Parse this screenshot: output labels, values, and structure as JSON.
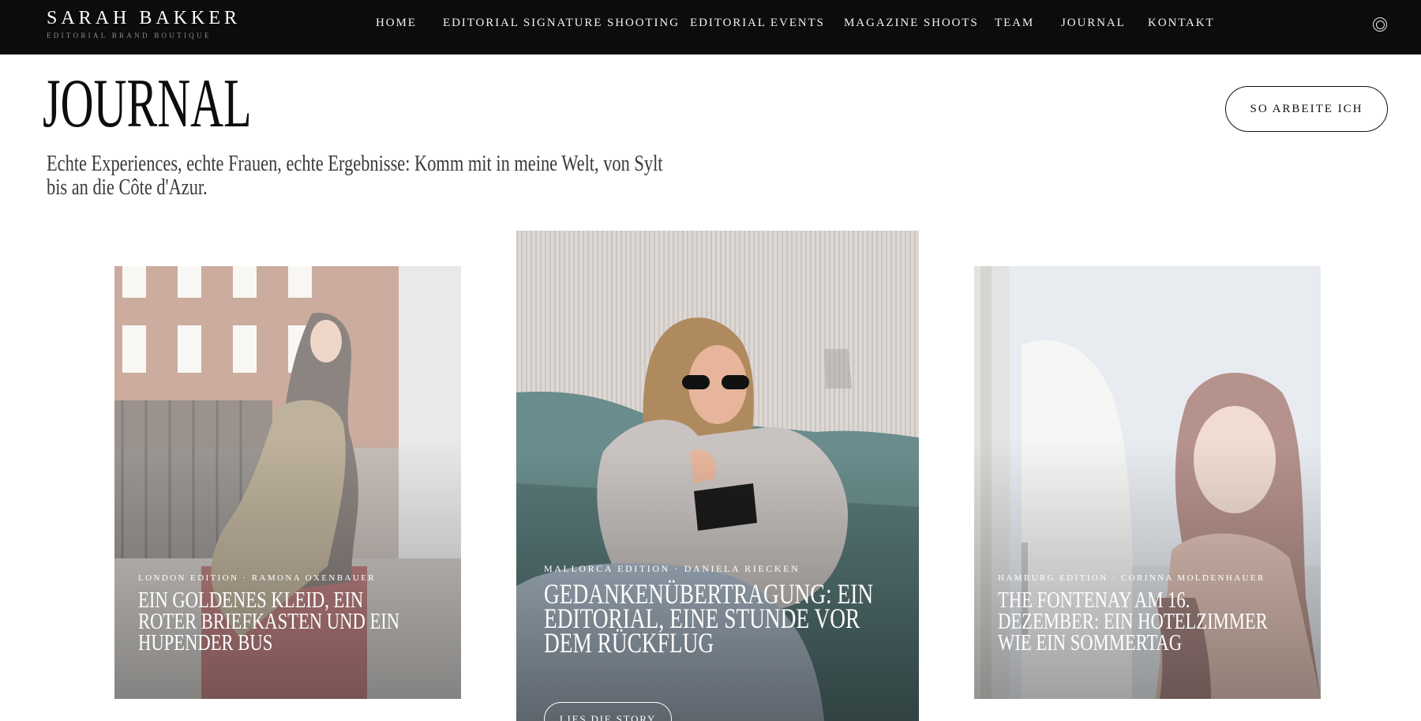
{
  "header": {
    "brand_name": "SARAH BAKKER",
    "brand_tagline": "EDITORIAL BRAND BOUTIQUE",
    "nav": [
      {
        "label": "HOME"
      },
      {
        "label": "EDITORIAL SIGNATURE SHOOTING"
      },
      {
        "label": "EDITORIAL EVENTS"
      },
      {
        "label": "MAGAZINE SHOOTS"
      },
      {
        "label": "TEAM"
      },
      {
        "label": "JOURNAL"
      },
      {
        "label": "KONTAKT"
      }
    ],
    "social_icon": "instagram-icon"
  },
  "page": {
    "title": "JOURNAL",
    "intro": "Echte Experiences, echte Frauen, echte Ergebnisse: Komm mit in meine Welt, von Sylt bis an die Côte d'Azur.",
    "cta_label": "SO ARBEITE ICH"
  },
  "cards": [
    {
      "meta": "LONDON EDITION · RAMONA OXENBAUER",
      "title": "EIN GOLDENES KLEID, EIN ROTER BRIEFKASTEN UND EIN HUPENDER BUS"
    },
    {
      "meta": "MALLORCA EDITION · DANIELA RIECKEN",
      "title": "GEDANKENÜBERTRAGUNG: EIN EDITORIAL, EINE STUNDE VOR DEM RÜCKFLUG",
      "button_label": "LIES DIE STORY"
    },
    {
      "meta": "HAMBURG EDITION · CORINNA MOLDENHAUER",
      "title": "THE FONTENAY AM 16. DEZEMBER: EIN HOTELZIMMER WIE EIN SOMMERTAG"
    }
  ],
  "colors": {
    "header_bg": "#0c0c0c",
    "text_dark": "#111111",
    "text_light": "#ffffff",
    "sofa_teal": "#6a8c8c"
  }
}
